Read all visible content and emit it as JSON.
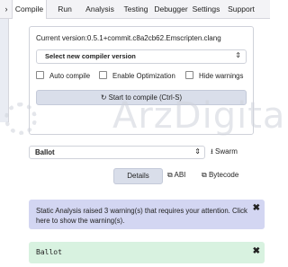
{
  "nav": {
    "chevron": "›",
    "tabs": [
      {
        "label": "Compile",
        "active": true
      },
      {
        "label": "Run",
        "active": false
      },
      {
        "label": "Analysis",
        "active": false
      },
      {
        "label": "Testing",
        "active": false
      },
      {
        "label": "Debugger",
        "active": false
      },
      {
        "label": "Settings",
        "active": false
      },
      {
        "label": "Support",
        "active": false
      }
    ]
  },
  "compiler": {
    "current_version": "Current version:0.5.1+commit.c8a2cb62.Emscripten.clang",
    "select_label": "Select new compiler version",
    "options": {
      "auto_compile": "Auto compile",
      "enable_optimization": "Enable Optimization",
      "hide_warnings": "Hide warnings"
    },
    "compile_button": "Start to compile (Ctrl-S)"
  },
  "watermark": {
    "text": "ArzDigital"
  },
  "contract": {
    "selected": "Ballot",
    "swarm_label": "Swarm",
    "details_label": "Details",
    "abi_label": "ABI",
    "bytecode_label": "Bytecode"
  },
  "alerts": {
    "warning_text": "Static Analysis raised 3 warning(s) that requires your attention. Click here to show the warning(s).",
    "success_text": "Ballot",
    "close_glyph": "✖"
  },
  "colors": {
    "button_bg": "#d9deea",
    "warning_bg": "#d3d6f2",
    "success_bg": "#d8f2e0"
  }
}
